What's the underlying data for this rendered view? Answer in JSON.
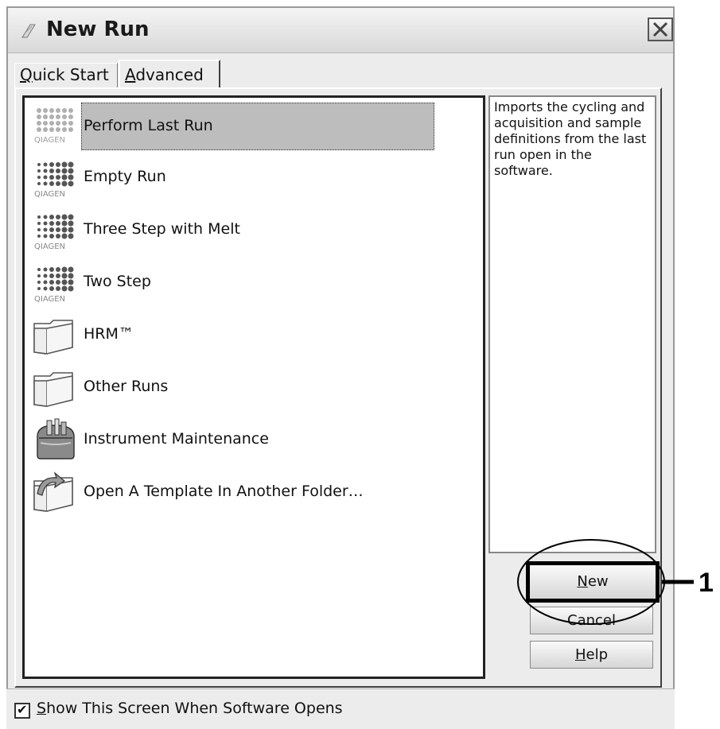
{
  "window": {
    "title": "New Run",
    "close_label": "×"
  },
  "tabs": [
    {
      "label": "Quick Start",
      "underline_char": "Q",
      "rest": "uick Start",
      "active": false
    },
    {
      "label": "Advanced",
      "underline_char": "A",
      "rest": "dvanced",
      "active": true
    }
  ],
  "list": {
    "items": [
      {
        "label": "Perform Last Run",
        "icon": "qiagen-dots-icon",
        "selected": true
      },
      {
        "label": "Empty Run",
        "icon": "qiagen-dots-icon",
        "selected": false
      },
      {
        "label": "Three Step with Melt",
        "icon": "qiagen-dots-icon",
        "selected": false
      },
      {
        "label": "Two Step",
        "icon": "qiagen-dots-icon",
        "selected": false
      },
      {
        "label": "HRM™",
        "icon": "folder-icon",
        "selected": false
      },
      {
        "label": "Other Runs",
        "icon": "folder-icon",
        "selected": false
      },
      {
        "label": "Instrument Maintenance",
        "icon": "toolbox-icon",
        "selected": false
      },
      {
        "label": "Open A Template In Another Folder…",
        "icon": "folder-open-arrow-icon",
        "selected": false
      }
    ]
  },
  "description": {
    "text": "Imports the cycling and acquisition and sample definitions from the last run open in the software."
  },
  "buttons": {
    "new": {
      "underline_char": "N",
      "rest": "ew"
    },
    "cancel": {
      "label": "Cancel"
    },
    "help": {
      "underline_char": "H",
      "rest": "elp"
    }
  },
  "annotation": {
    "number": "1"
  },
  "footer": {
    "checkbox_checked": true,
    "check_mark": "✔",
    "label_underline": "S",
    "label_rest": "how This Screen When Software Opens"
  },
  "icon_glyphs": {
    "qiagen_brand": "QIAGEN"
  }
}
